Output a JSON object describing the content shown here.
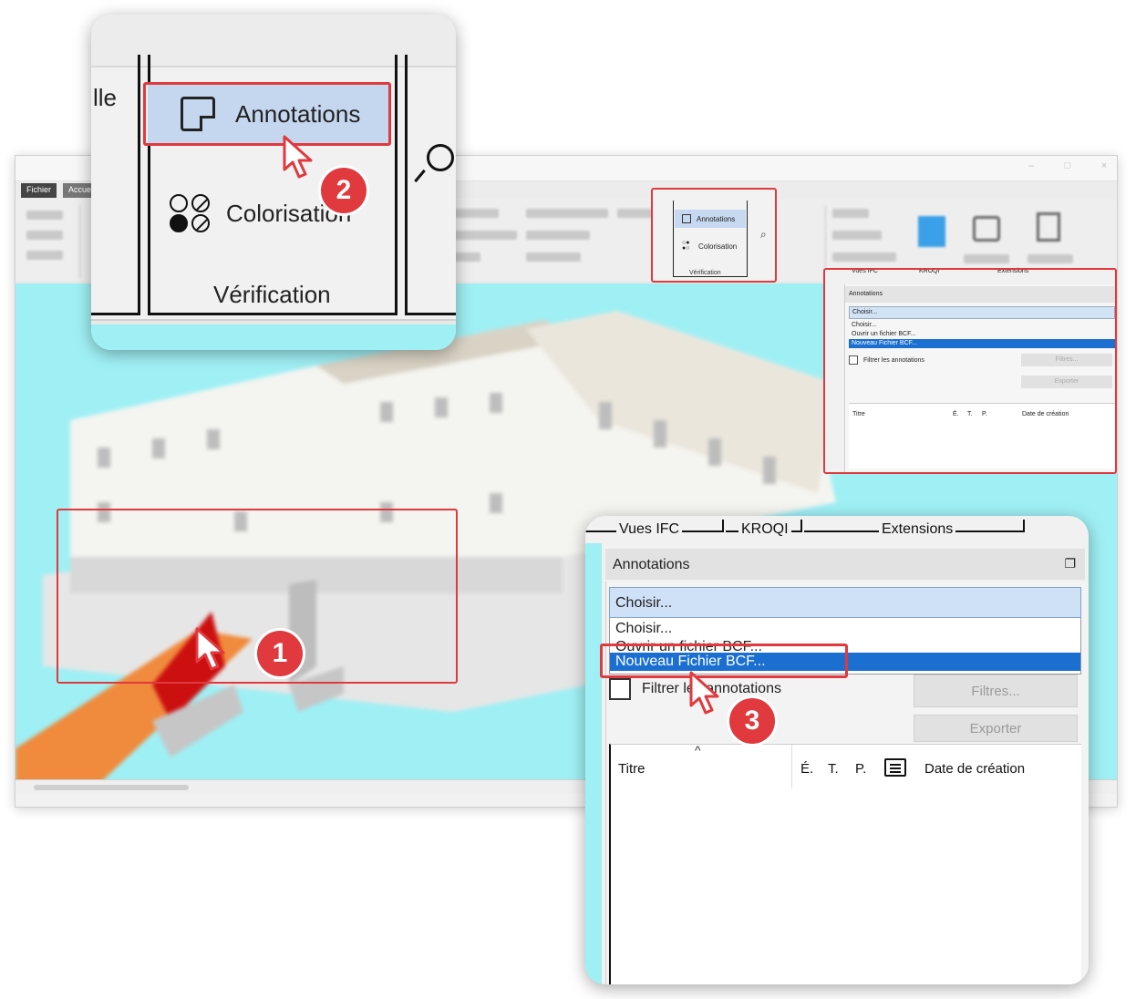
{
  "app": {
    "window_controls": [
      "‒",
      "□",
      "×"
    ],
    "menu_tabs": [
      "Fichier",
      "Accueil"
    ],
    "ribbon": {
      "verification_group": {
        "label": "Vérification",
        "annotations_label": "Annotations",
        "colorisation_label": "Colorisation"
      },
      "fragment_left": "lle"
    }
  },
  "panel": {
    "tabs": [
      "Vues IFC",
      "KROQI",
      "Extensions"
    ],
    "header": "Annotations",
    "select": {
      "value": "Choisir..."
    },
    "dropdown_options": [
      {
        "label": "Choisir...",
        "selected": false
      },
      {
        "label": "Ouvrir un fichier BCF...",
        "selected": false
      },
      {
        "label": "Nouveau Fichier BCF...",
        "selected": true
      }
    ],
    "filter_checkbox": {
      "label": "Filtrer les annotations",
      "checked": false
    },
    "buttons": {
      "filters": "Filtres...",
      "export": "Exporter"
    },
    "table_columns": [
      "Titre",
      "É.",
      "T.",
      "P.",
      "Date de création"
    ]
  },
  "steps": [
    "1",
    "2",
    "3"
  ],
  "colors": {
    "highlight": "#e0393e",
    "selection": "#1a6fd1",
    "hover": "#c5d6ef",
    "viewport": "#9ff0f5"
  }
}
